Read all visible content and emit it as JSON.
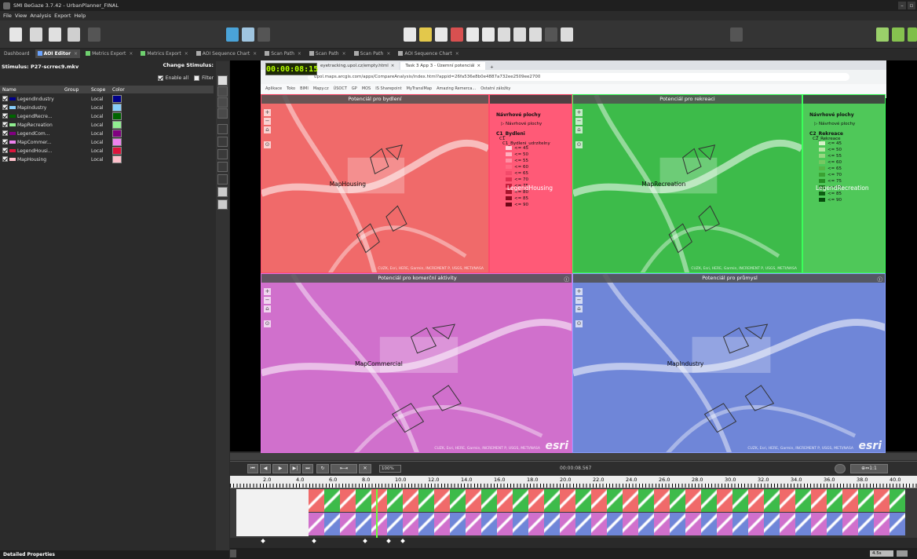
{
  "window": {
    "title": "SMI BeGaze 3.7.42 - UrbanPlanner_FINAL"
  },
  "menu": [
    "File",
    "View",
    "Analysis",
    "Export",
    "Help"
  ],
  "tabs": [
    {
      "label": "Dashboard",
      "active": false
    },
    {
      "label": "AOI Editor",
      "active": true
    },
    {
      "label": "Metrics Export",
      "active": false
    },
    {
      "label": "Metrics Export",
      "active": false
    },
    {
      "label": "AOI Sequence Chart",
      "active": false
    },
    {
      "label": "Scan Path",
      "active": false
    },
    {
      "label": "Scan Path",
      "active": false
    },
    {
      "label": "Scan Path",
      "active": false
    },
    {
      "label": "AOI Sequence Chart",
      "active": false
    }
  ],
  "left_panel": {
    "stimulus_label": "Stimulus: P27-scrrec9.mkv",
    "change_stimulus_label": "Change Stimulus:",
    "enable_all_label": "Enable all",
    "filter_label": "Filter",
    "columns": [
      "Name",
      "Group",
      "Scope",
      "Color"
    ],
    "aois": [
      {
        "name": "LegendIndustry",
        "scope": "Local",
        "color": "#00008b"
      },
      {
        "name": "MapIndustry",
        "scope": "Local",
        "color": "#87cefa"
      },
      {
        "name": "LegendRecre...",
        "scope": "Local",
        "color": "#006400"
      },
      {
        "name": "MapRecreation",
        "scope": "Local",
        "color": "#90ee90"
      },
      {
        "name": "LegendCom...",
        "scope": "Local",
        "color": "#800080"
      },
      {
        "name": "MapCommer...",
        "scope": "Local",
        "color": "#ee82ee"
      },
      {
        "name": "LegendHousi...",
        "scope": "Local",
        "color": "#dc143c"
      },
      {
        "name": "MapHousing",
        "scope": "Local",
        "color": "#ffc0cb"
      }
    ],
    "detail_properties_label": "Detailed Properties"
  },
  "video": {
    "timer": "00:00:08:15",
    "browser_tabs": [
      "eyetracking.upol.cz/empty.html",
      "Task 3 App 3 - Územní potenciál"
    ],
    "address": "upol.maps.arcgis.com/apps/CompareAnalysis/index.html?appid=26fa536e8b0e4887a732ee2509ee2700",
    "bookmarks": [
      "Aplikace",
      "Toko",
      "BIMI",
      "Mapy.cz",
      "ÚSOCT",
      "GP",
      "MOS",
      "IS Sharepoint",
      "MyTranslMap",
      "Amazing Remerca...",
      "Ostatní záložky"
    ],
    "quadrants": [
      {
        "title": "Potenciál pro bydlení",
        "map_aoi": "MapHousing",
        "legend_aoi": "LegendHousing",
        "legend": {
          "title": "Návrhové plochy",
          "item": "Návrhové plochy",
          "layer": "C1_Bydleni",
          "sub": "C1",
          "field": "C1_Bydleni_udrzitelny",
          "classes": [
            "<= 45",
            "<= 50",
            "<= 55",
            "<= 60",
            "<= 65",
            "<= 70",
            "<= 75",
            "<= 80",
            "<= 85",
            "<= 90"
          ]
        }
      },
      {
        "title": "Potenciál pro rekreaci",
        "map_aoi": "MapRecreation",
        "legend_aoi": "LegendRecreation",
        "legend": {
          "title": "Návrhové plochy",
          "item": "Návrhové plochy",
          "layer": "C2_Rekreace",
          "sub": "C2_Rekreace",
          "classes": [
            "<= 45",
            "<= 50",
            "<= 55",
            "<= 60",
            "<= 65",
            "<= 70",
            "<= 75",
            "<= 80",
            "<= 85",
            "<= 90"
          ]
        }
      },
      {
        "title": "Potenciál pro komerční aktivity",
        "map_aoi": "MapCommercial"
      },
      {
        "title": "Potenciál pro průmysl",
        "map_aoi": "MapIndustry"
      }
    ],
    "attribution": "CUZK, Esri, HERE, Garmin, INCREMENT P, USGS, METI/NASA",
    "esri": "esri"
  },
  "playback": {
    "zoom": "100%",
    "current_time": "00:00:08.567",
    "ruler": [
      "2.0",
      "4.0",
      "6.0",
      "8.0",
      "10.0",
      "12.0",
      "14.0",
      "16.0",
      "18.0",
      "20.0",
      "22.0",
      "24.0",
      "26.0",
      "28.0",
      "30.0",
      "32.0",
      "34.0",
      "36.0",
      "38.0",
      "40.0"
    ],
    "scale_right": "4.5s"
  },
  "colors": {
    "housing": "#f06a6a",
    "recreation": "#3dbb4a",
    "commercial": "#d070cc",
    "industry": "#6f86d8"
  }
}
